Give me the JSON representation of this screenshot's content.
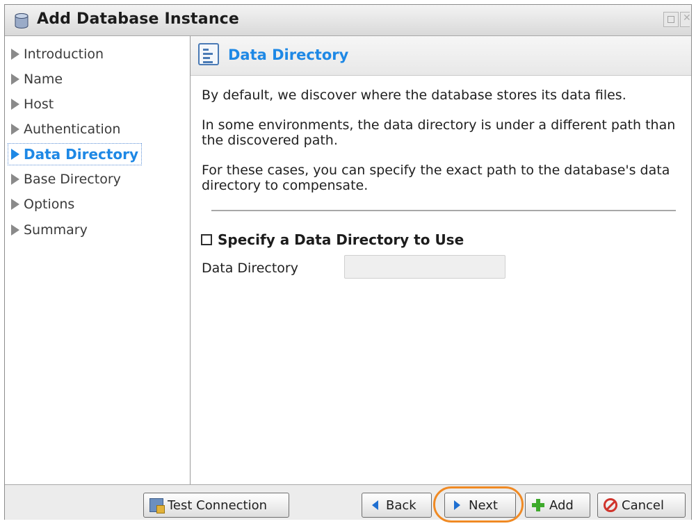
{
  "window": {
    "title": "Add Database Instance",
    "title_icon": "database-icon"
  },
  "sidebar": {
    "items": [
      {
        "label": "Introduction",
        "active": false
      },
      {
        "label": "Name",
        "active": false
      },
      {
        "label": "Host",
        "active": false
      },
      {
        "label": "Authentication",
        "active": false
      },
      {
        "label": "Data Directory",
        "active": true
      },
      {
        "label": "Base Directory",
        "active": false
      },
      {
        "label": "Options",
        "active": false
      },
      {
        "label": "Summary",
        "active": false
      }
    ]
  },
  "content": {
    "title": "Data Directory",
    "title_icon": "document-list-icon",
    "paragraphs": [
      "By default, we discover where the database stores its data files.",
      "In some environments, the data directory is under a different path than the discovered path.",
      "For these cases, you can specify the exact path to the database's data directory to compensate."
    ],
    "checkbox_label": "Specify a Data Directory to Use",
    "checkbox_checked": false,
    "field_label": "Data Directory",
    "field_value": ""
  },
  "footer": {
    "test_connection": "Test Connection",
    "back": "Back",
    "next": "Next",
    "add": "Add",
    "cancel": "Cancel"
  },
  "colors": {
    "accent": "#1e88e5",
    "highlight": "#f08a24"
  }
}
